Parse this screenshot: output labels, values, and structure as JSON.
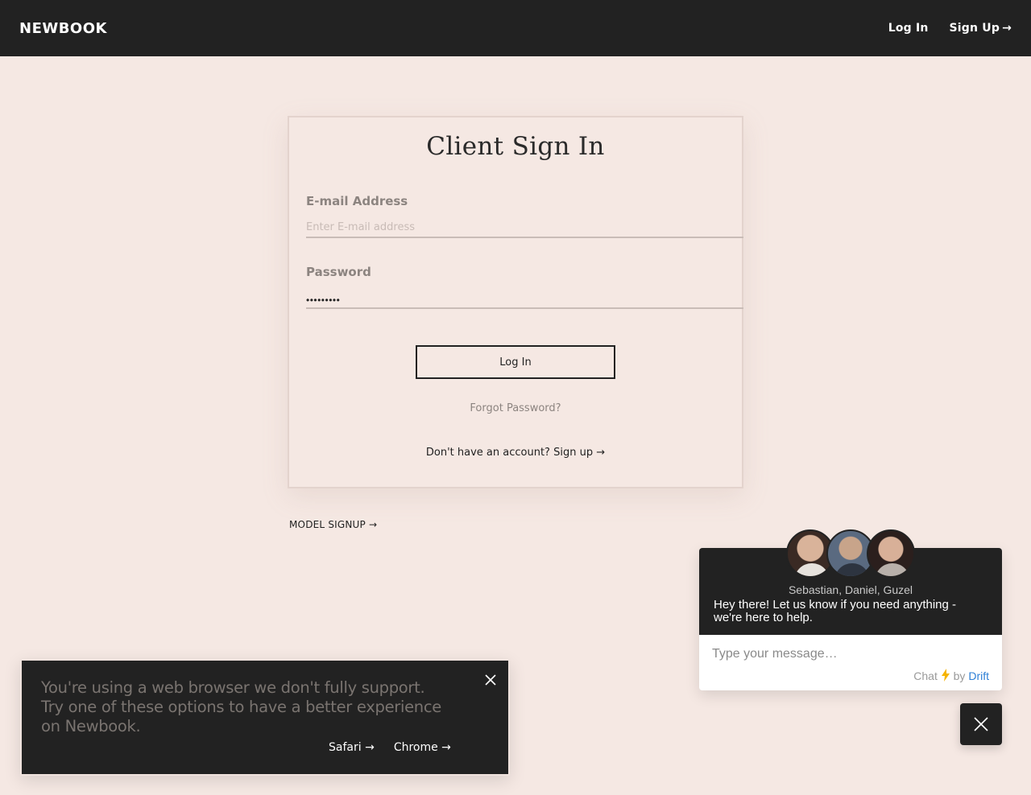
{
  "header": {
    "logo": "NEWBOOK",
    "login_label": "Log In",
    "signup_label": "Sign Up",
    "signup_arrow": "→"
  },
  "signin": {
    "title": "Client Sign In",
    "email_label": "E-mail Address",
    "email_placeholder": "Enter E-mail address",
    "email_value": "",
    "password_label": "Password",
    "password_masked": "•••••••••",
    "login_button": "Log In",
    "forgot_link": "Forgot Password?",
    "signup_prompt": "Don't have an account? Sign up →"
  },
  "model_signup": "MODEL SIGNUP →",
  "browser_warning": {
    "message": "You're using a web browser we don't fully support. Try one of these options to have a better experience on Newbook.",
    "safari_link": "Safari →",
    "chrome_link": "Chrome →"
  },
  "chat": {
    "names": "Sebastian, Daniel, Guzel",
    "greeting": "Hey there! Let us know if you need anything - we're here to help.",
    "input_placeholder": "Type your message…",
    "brand_prefix": "Chat",
    "brand_by": "by",
    "brand_name": "Drift"
  },
  "colors": {
    "background": "#f5e8e3",
    "dark": "#222222",
    "muted_text": "#8c8480",
    "drift_blue": "#2d7fd6",
    "bolt": "#f5b400"
  },
  "icons": [
    "arrow-right-icon",
    "close-icon",
    "lightning-icon"
  ]
}
